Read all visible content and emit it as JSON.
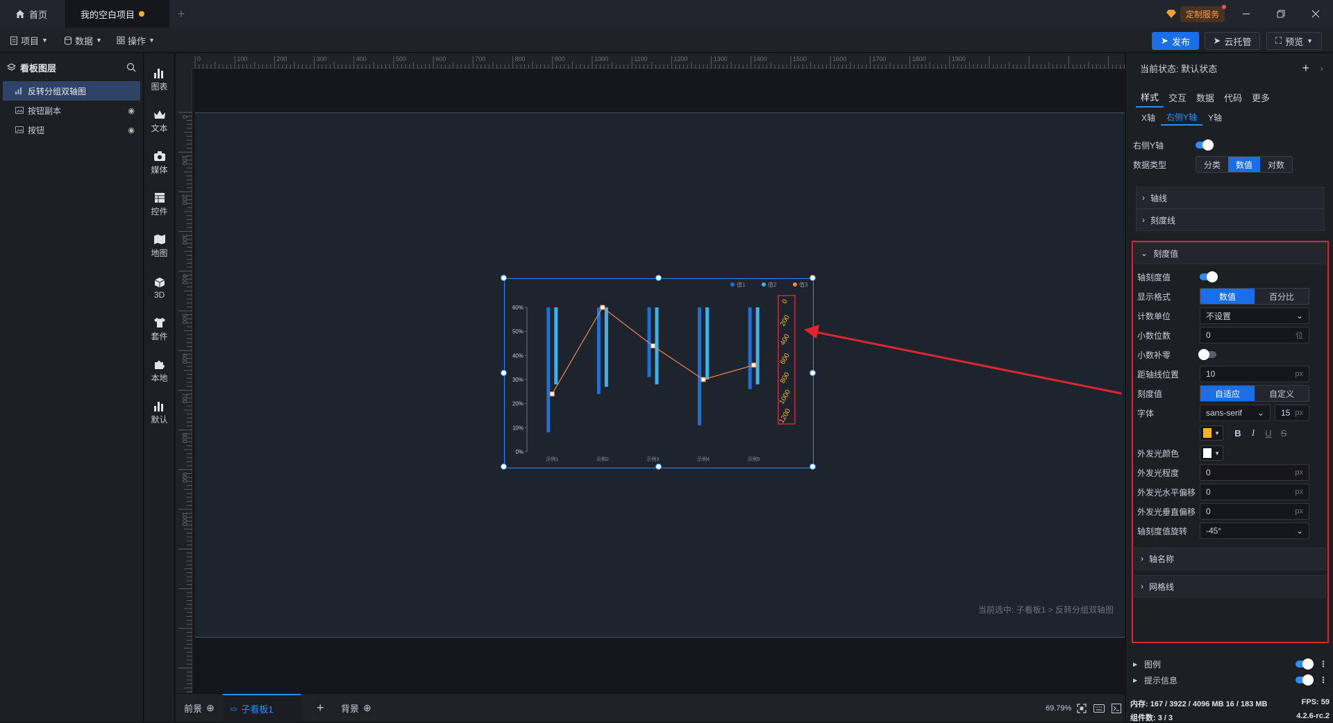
{
  "titlebar": {
    "home_tab": "首页",
    "project_tab": "我的空白项目",
    "custom_service": "定制服务"
  },
  "toolbar": {
    "project": "项目",
    "data": "数据",
    "operate": "操作",
    "publish": "发布",
    "cloud": "云托管",
    "preview": "预览"
  },
  "layers": {
    "title": "看板图层",
    "items": [
      {
        "label": "反转分组双轴图",
        "active": true
      },
      {
        "label": "按钮副本"
      },
      {
        "label": "按钮"
      }
    ]
  },
  "rail": [
    "图表",
    "文本",
    "媒体",
    "控件",
    "地图",
    "3D",
    "套件",
    "本地",
    "默认"
  ],
  "canvas": {
    "selection_prefix": "当前选中:",
    "selection_board": "子看板1",
    "selection_sep": ">",
    "selection_item": "反转分组双轴图"
  },
  "ruler": {
    "top": [
      "0",
      "100",
      "200",
      "300",
      "400",
      "500",
      "600",
      "700",
      "800",
      "900",
      "1000",
      "1100",
      "1200",
      "1300",
      "1400",
      "1500",
      "1600",
      "1700",
      "1800",
      "1900"
    ],
    "left": [
      "0",
      "100",
      "200",
      "300",
      "400",
      "500",
      "600",
      "700",
      "800",
      "900",
      "1000"
    ]
  },
  "chart_data": {
    "type": "bar",
    "categories": [
      "示例1",
      "示例2",
      "示例3",
      "示例4",
      "示例5"
    ],
    "legend": [
      "值1",
      "值2",
      "值3"
    ],
    "legend_colors": [
      "#1f6fd8",
      "#3fb0e8",
      "#f08a4b"
    ],
    "left_ticks": [
      "60%",
      "50%",
      "40%",
      "30%",
      "20%",
      "10%",
      "0%"
    ],
    "right_ticks": [
      "0",
      "200",
      "400",
      "600",
      "800",
      "1000",
      "1200"
    ],
    "right_tick_color": "#f5b426",
    "series": [
      {
        "name": "值1",
        "from": [
          0,
          0,
          0,
          0,
          0
        ],
        "to": [
          52,
          36,
          29,
          49,
          34
        ]
      },
      {
        "name": "值2",
        "from": [
          0,
          0,
          0,
          0,
          0
        ],
        "to": [
          32,
          33,
          32,
          30,
          32
        ]
      }
    ],
    "line": {
      "name": "值3",
      "values": [
        24,
        60,
        44,
        30,
        36
      ]
    },
    "ylim": [
      0,
      60
    ]
  },
  "bottombar": {
    "front": "前景",
    "subboard": "子看板1",
    "background": "背景",
    "zoom": "69.79%"
  },
  "panel": {
    "state_label": "当前状态:",
    "state_value": "默认状态",
    "tabs": [
      "样式",
      "交互",
      "数据",
      "代码",
      "更多"
    ],
    "subtabs": [
      "X轴",
      "右侧Y轴",
      "Y轴"
    ],
    "right_y_label": "右侧Y轴",
    "data_type_label": "数据类型",
    "data_type_options": [
      "分类",
      "数值",
      "对数"
    ],
    "section_axis_line": "轴线",
    "section_tick_line": "刻度线",
    "section_tick_value": "刻度值",
    "axis_tick_value": "轴刻度值",
    "display_format": "显示格式",
    "display_format_options": [
      "数值",
      "百分比"
    ],
    "count_unit": "计数单位",
    "count_unit_value": "不设置",
    "decimal_places": "小数位数",
    "decimal_places_value": "0",
    "decimal_unit": "位",
    "decimal_pad": "小数补零",
    "axis_distance": "距轴线位置",
    "axis_distance_value": "10",
    "px": "px",
    "tick_value": "刻度值",
    "tick_value_options": [
      "自适应",
      "自定义"
    ],
    "font_label": "字体",
    "font_family_value": "sans-serif",
    "font_size_value": "15",
    "font_color": "#f5b426",
    "glow_color_label": "外发光颜色",
    "glow_color": "#ffffff",
    "glow_level": "外发光程度",
    "glow_level_value": "0",
    "glow_h": "外发光水平偏移",
    "glow_h_value": "0",
    "glow_v": "外发光垂直偏移",
    "glow_v_value": "0",
    "rotate_label": "轴刻度值旋转",
    "rotate_value": "-45°",
    "section_axis_name": "轴名称",
    "section_grid": "网格线",
    "section_legend": "图例",
    "section_tooltip": "提示信息"
  },
  "status": {
    "memory": "内存: 167 / 3922 / 4096 MB  16 / 183 MB",
    "fps": "FPS: 59",
    "components": "组件数: 3 / 3",
    "version": "4.2.6-rc.2"
  }
}
